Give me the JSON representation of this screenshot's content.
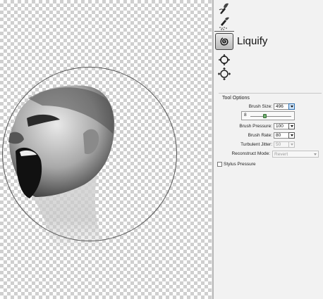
{
  "tools": {
    "active_tool_label": "Liquify"
  },
  "tool_options": {
    "title": "Tool Options",
    "brush_size": {
      "label": "Brush Size:",
      "value": "496"
    },
    "brush_size_slider": {
      "min_label": "8",
      "level_fraction": 0.35
    },
    "brush_pressure": {
      "label": "Brush Pressure:",
      "value": "100"
    },
    "brush_rate": {
      "label": "Brush Rate:",
      "value": "80"
    },
    "turbulent_jitter": {
      "label": "Turbulent Jitter:",
      "value": "50"
    },
    "reconstruct_mode": {
      "label": "Reconstruct Mode:",
      "value": "Revert"
    },
    "stylus_pressure": {
      "label": "Stylus Pressure",
      "checked": false
    }
  },
  "colors": {
    "checker": "#cfcfcf",
    "panel_bg": "#f2f2f2",
    "active_dropdown": "#cfe3f7",
    "slider_thumb": "#6fb06f"
  }
}
